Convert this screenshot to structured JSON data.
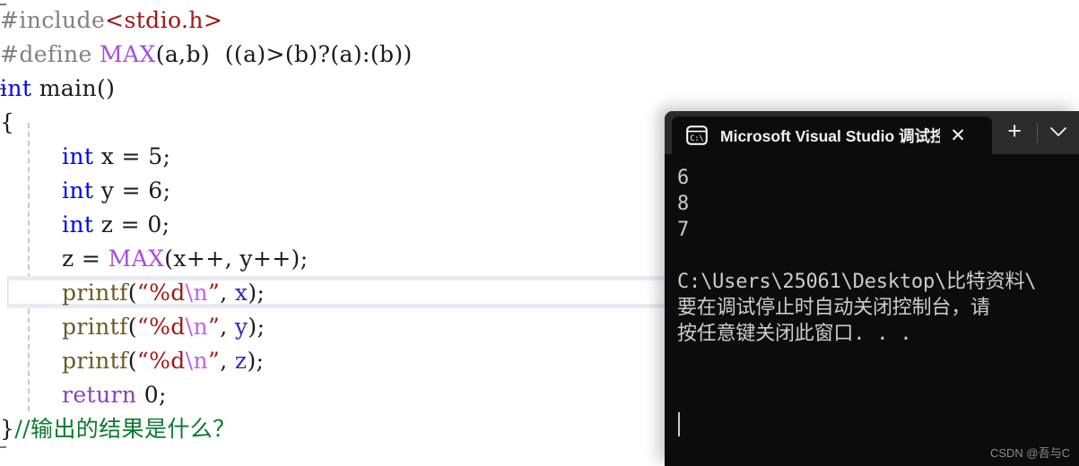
{
  "editor": {
    "name": "code-editor",
    "language": "C",
    "current_line_number": 10,
    "lines": [
      {
        "indent": 0,
        "tokens": [
          {
            "t": "#include",
            "c": "tok-pre"
          },
          {
            "t": "<stdio.h>",
            "c": "tok-header"
          }
        ]
      },
      {
        "indent": 0,
        "tokens": [
          {
            "t": "#define ",
            "c": "tok-pre"
          },
          {
            "t": "MAX",
            "c": "tok-macro"
          },
          {
            "t": "(a,b)  ((a)>(b)?(a):(b))",
            "c": "tok-plain"
          }
        ]
      },
      {
        "indent": 0,
        "tokens": [
          {
            "t": "int",
            "c": "tok-keyword"
          },
          {
            "t": " main()",
            "c": "tok-plain"
          }
        ]
      },
      {
        "indent": 0,
        "tokens": [
          {
            "t": "{",
            "c": "tok-plain"
          }
        ]
      },
      {
        "indent": 1,
        "tokens": [
          {
            "t": "int",
            "c": "tok-keyword"
          },
          {
            "t": " ",
            "c": "tok-plain"
          },
          {
            "t": "x",
            "c": "tok-plain"
          },
          {
            "t": " = 5;",
            "c": "tok-plain"
          }
        ]
      },
      {
        "indent": 1,
        "tokens": [
          {
            "t": "int",
            "c": "tok-keyword"
          },
          {
            "t": " ",
            "c": "tok-plain"
          },
          {
            "t": "y",
            "c": "tok-plain"
          },
          {
            "t": " = 6;",
            "c": "tok-plain"
          }
        ]
      },
      {
        "indent": 1,
        "tokens": [
          {
            "t": "int",
            "c": "tok-keyword"
          },
          {
            "t": " ",
            "c": "tok-plain"
          },
          {
            "t": "z",
            "c": "tok-plain"
          },
          {
            "t": " = 0;",
            "c": "tok-plain"
          }
        ]
      },
      {
        "indent": 1,
        "tokens": [
          {
            "t": "z = ",
            "c": "tok-plain"
          },
          {
            "t": "MAX",
            "c": "tok-macro"
          },
          {
            "t": "(x++, y++);",
            "c": "tok-plain"
          }
        ]
      },
      {
        "indent": 1,
        "tokens": [
          {
            "t": "printf",
            "c": "tok-func"
          },
          {
            "t": "(",
            "c": "tok-punct"
          },
          {
            "t": "“%d",
            "c": "tok-string"
          },
          {
            "t": "\\n",
            "c": "tok-esc"
          },
          {
            "t": "”",
            "c": "tok-string"
          },
          {
            "t": ", ",
            "c": "tok-plain"
          },
          {
            "t": "x",
            "c": "tok-var"
          },
          {
            "t": ");",
            "c": "tok-plain"
          }
        ]
      },
      {
        "indent": 1,
        "tokens": [
          {
            "t": "printf",
            "c": "tok-func"
          },
          {
            "t": "(",
            "c": "tok-punct"
          },
          {
            "t": "“%d",
            "c": "tok-string"
          },
          {
            "t": "\\n",
            "c": "tok-esc"
          },
          {
            "t": "”",
            "c": "tok-string"
          },
          {
            "t": ", ",
            "c": "tok-plain"
          },
          {
            "t": "y",
            "c": "tok-var"
          },
          {
            "t": ");",
            "c": "tok-plain"
          }
        ]
      },
      {
        "indent": 1,
        "tokens": [
          {
            "t": "printf",
            "c": "tok-func"
          },
          {
            "t": "(",
            "c": "tok-punct"
          },
          {
            "t": "“%d",
            "c": "tok-string"
          },
          {
            "t": "\\n",
            "c": "tok-esc"
          },
          {
            "t": "”",
            "c": "tok-string"
          },
          {
            "t": ", ",
            "c": "tok-plain"
          },
          {
            "t": "z",
            "c": "tok-var"
          },
          {
            "t": ");",
            "c": "tok-plain"
          }
        ]
      },
      {
        "indent": 1,
        "tokens": [
          {
            "t": "return",
            "c": "tok-kw2"
          },
          {
            "t": " 0;",
            "c": "tok-plain"
          }
        ]
      },
      {
        "indent": 0,
        "tokens": [
          {
            "t": "}",
            "c": "tok-plain"
          },
          {
            "t": "//输出的结果是什么？",
            "c": "tok-comment"
          }
        ]
      }
    ]
  },
  "console": {
    "icon": "terminal-icon",
    "tab_title": "Microsoft Visual Studio 调试控",
    "close_label": "✕",
    "new_tab_label": "+",
    "dropdown_icon": "chevron-down-icon",
    "output_lines": [
      "6",
      "8",
      "7",
      "",
      "C:\\Users\\25061\\Desktop\\比特资料\\",
      "要在调试停止时自动关闭控制台，请",
      "按任意键关闭此窗口. . ."
    ]
  },
  "watermark": {
    "text": "CSDN @吾与C"
  },
  "colors": {
    "console_bg": "#0c0c0c",
    "console_titlebar": "#2b2b2b",
    "console_text": "#cccccc",
    "editor_bg": "#ffffff",
    "keyword_blue": "#0000ff",
    "macro_purple": "#a64ce0",
    "string_red": "#a31515",
    "comment_green": "#0a7a2e",
    "current_line_border": "#e3e4f0"
  }
}
